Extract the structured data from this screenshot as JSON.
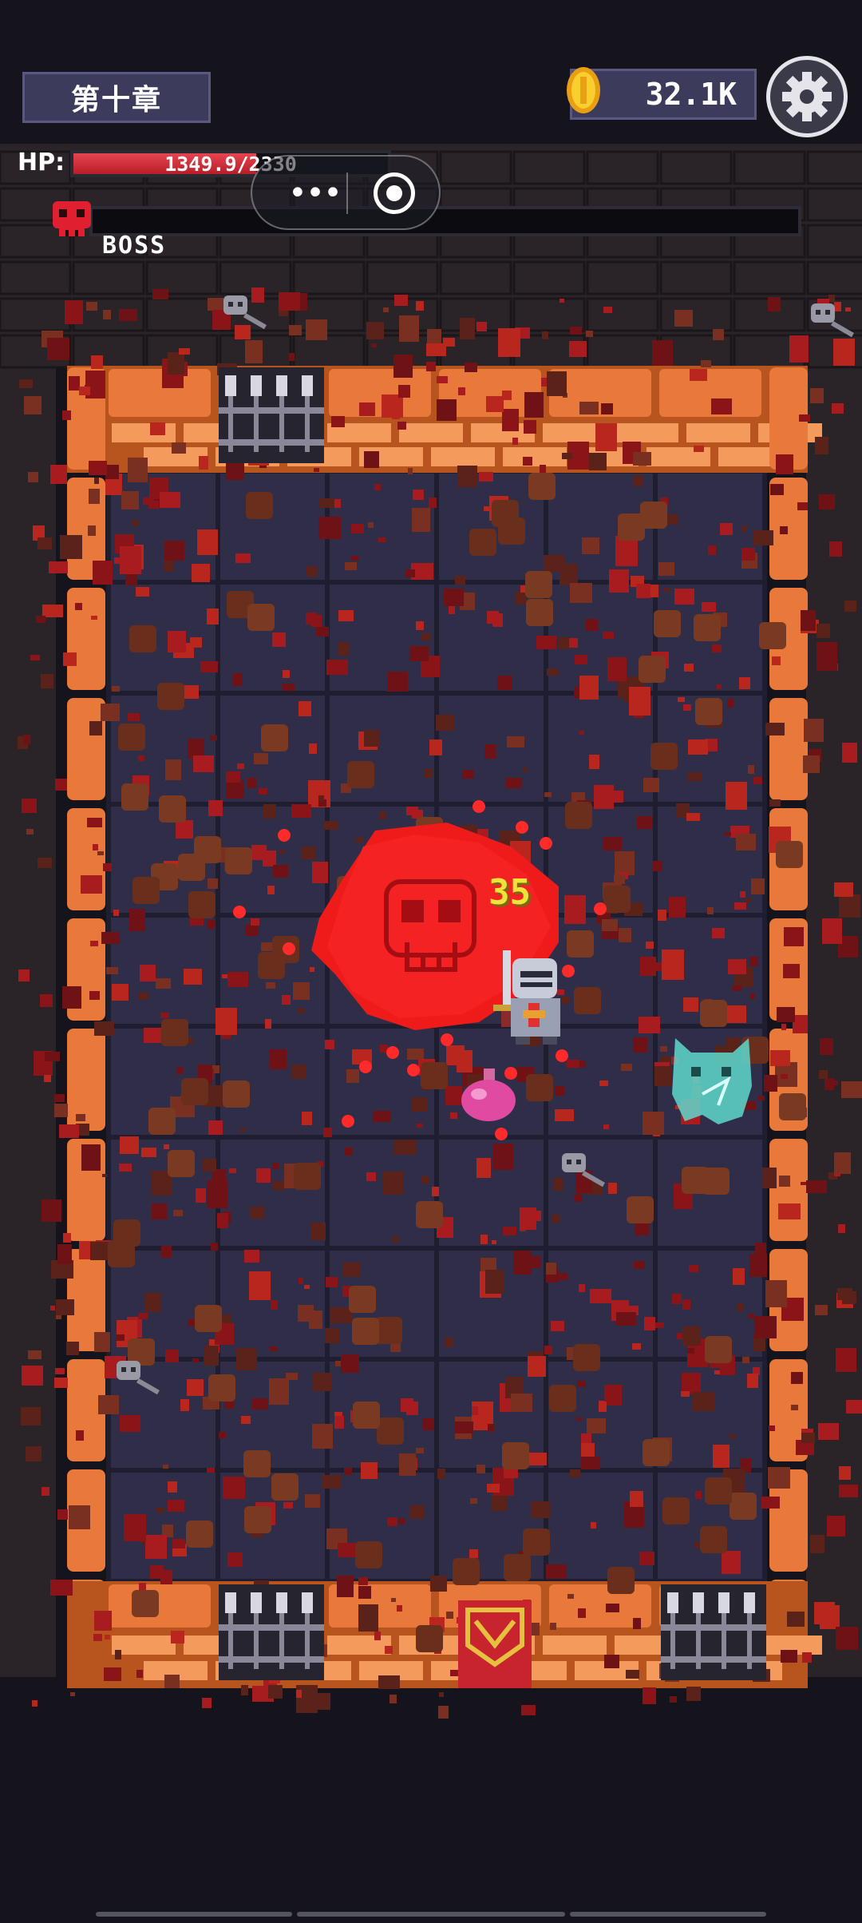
{
  "header": {
    "chapter_label": "第十章",
    "coin_amount": "32.1K",
    "coin_icon": "gold-coin-icon",
    "settings_icon": "gear-icon"
  },
  "player": {
    "hp_label": "HP:",
    "hp_text": "1349.9/2330",
    "hp_fraction": 0.58
  },
  "miniprogram_capsule": {
    "more_icon": "more-dots-icon",
    "close_icon": "record-circle-icon",
    "more_glyph": "•••"
  },
  "boss": {
    "label": "BOSS",
    "hp_fraction": 0.0,
    "icon": "red-skull-icon"
  },
  "battle": {
    "damage_number": "35"
  },
  "colors": {
    "wall_orange": "#e8793a",
    "floor": "#34324f",
    "blood": "#a01820",
    "ui_panel": "#3d3b5c",
    "hp_red": "#d8323c",
    "ghost_cyan": "#6fe3d6"
  }
}
